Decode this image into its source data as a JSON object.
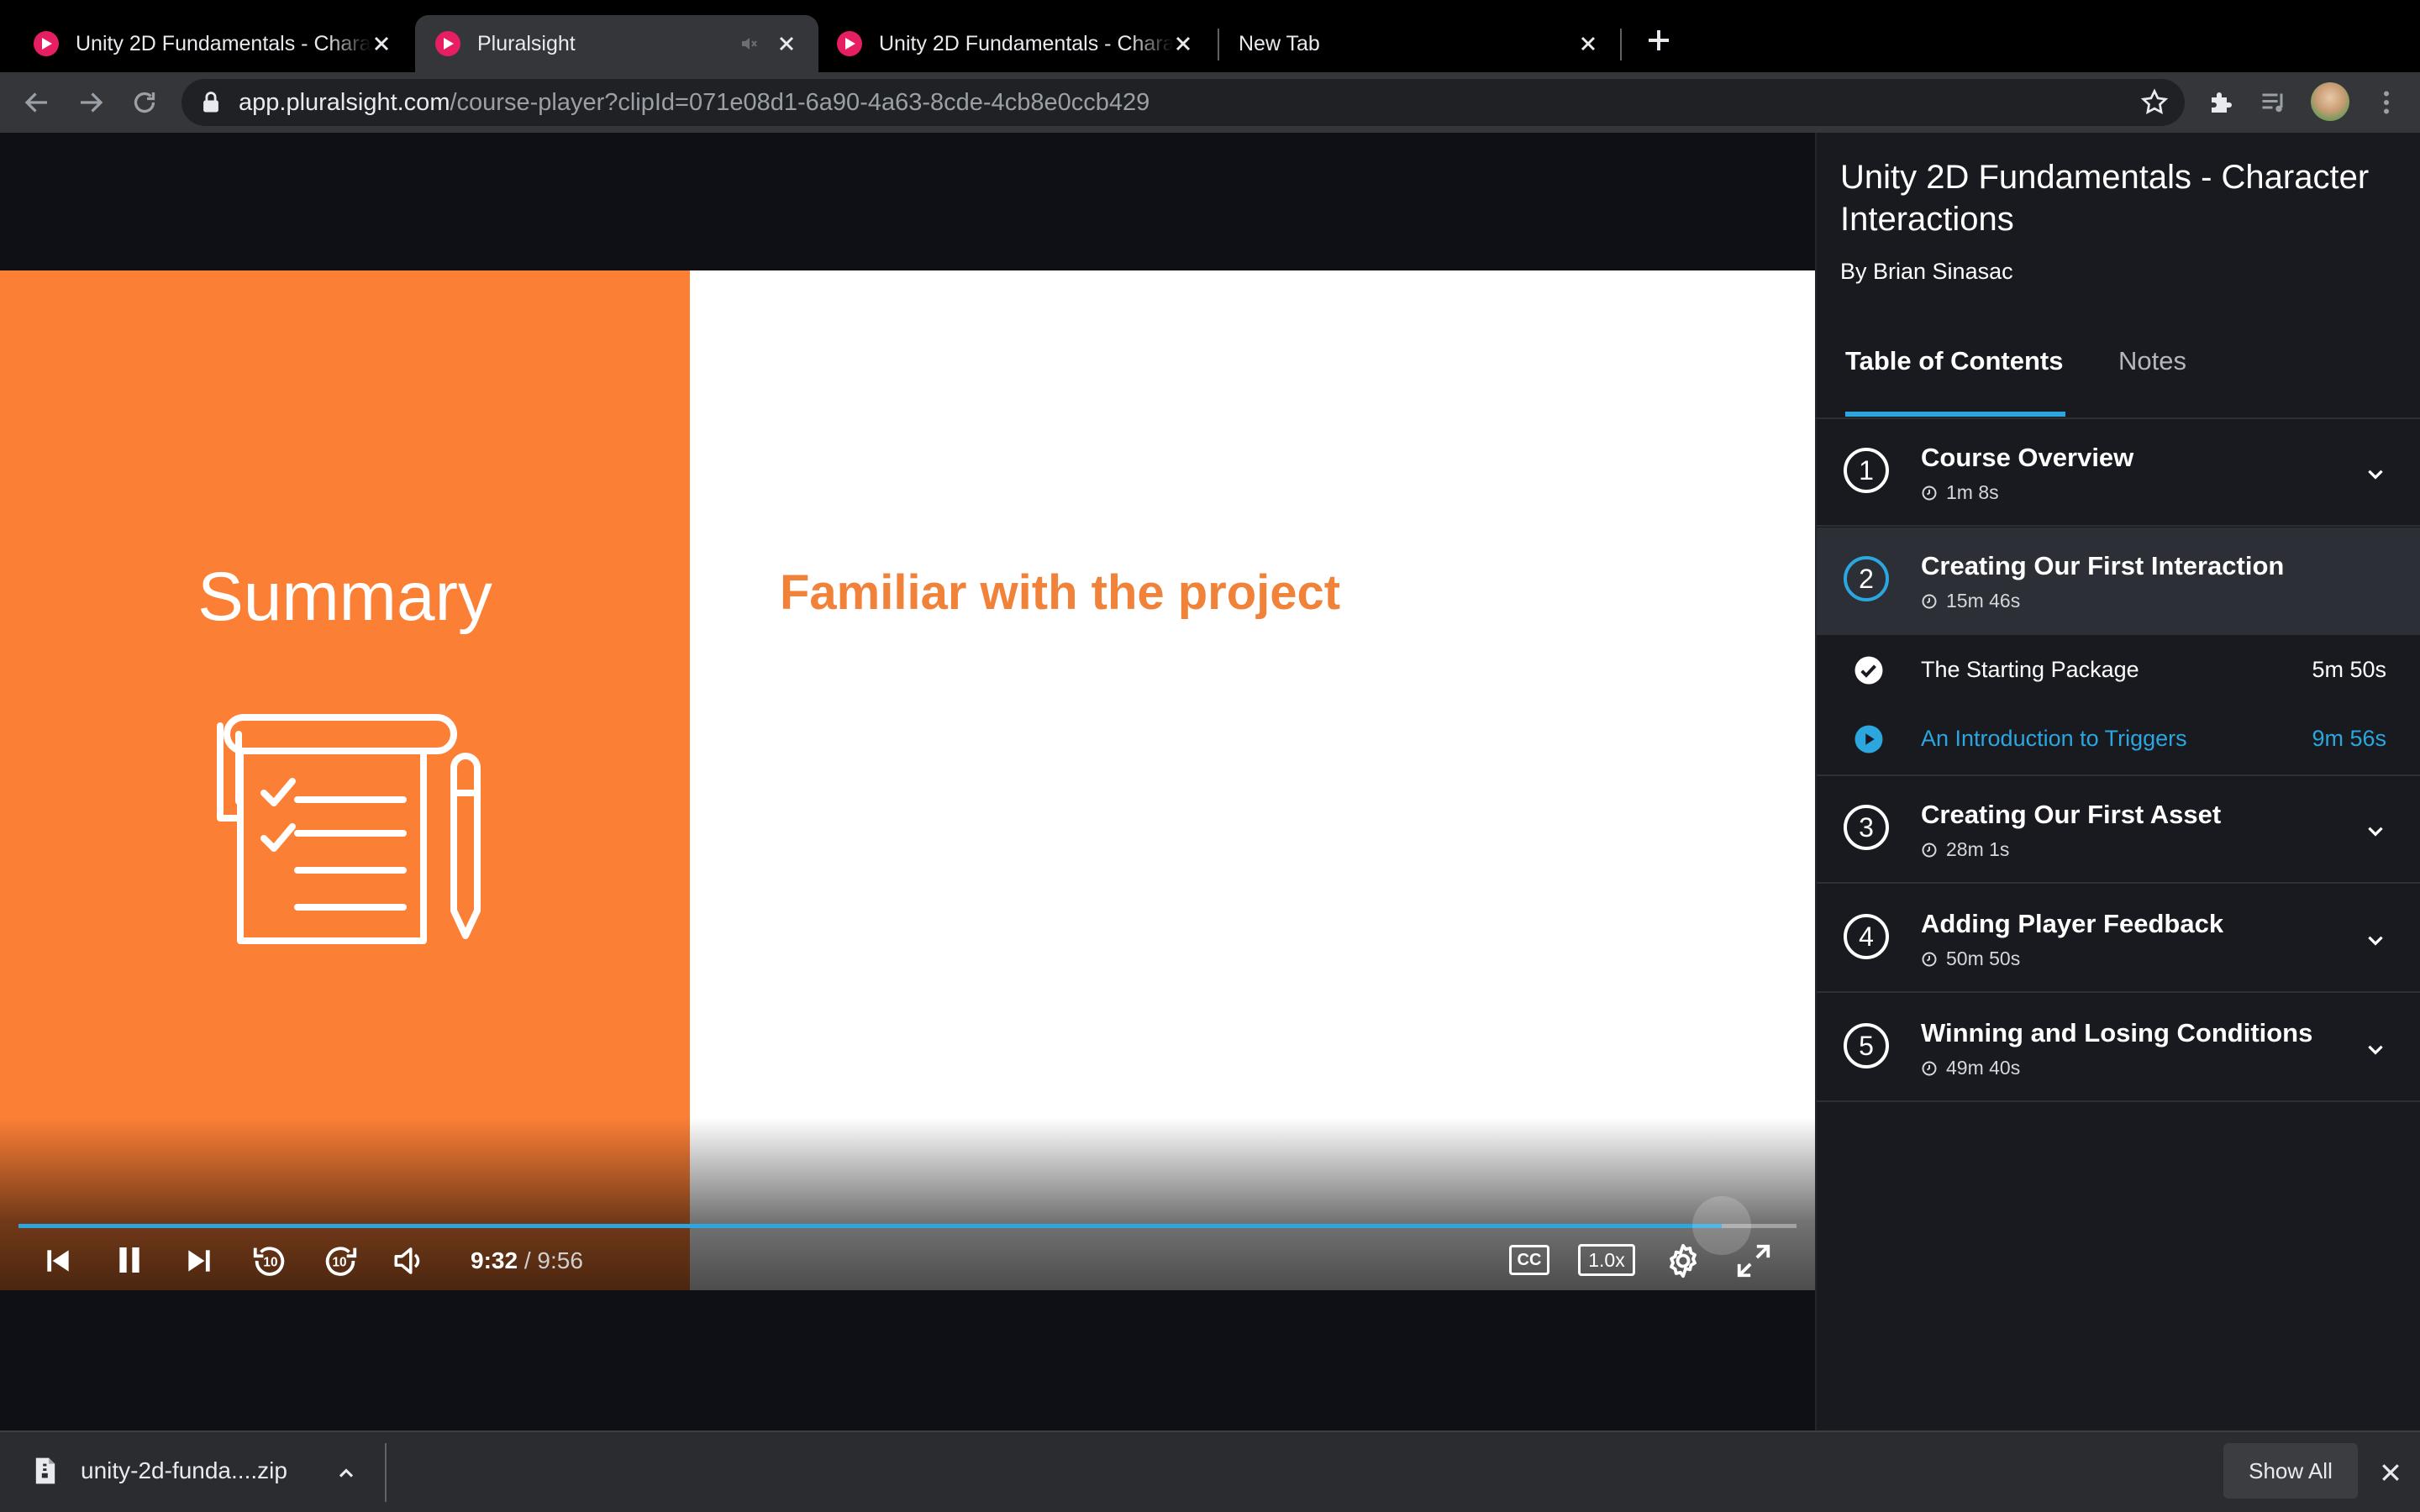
{
  "browser": {
    "tabs": [
      {
        "title": "Unity 2D Fundamentals - Character Interactions",
        "active": false
      },
      {
        "title": "Pluralsight",
        "active": true,
        "audible": true
      },
      {
        "title": "Unity 2D Fundamentals - Character Interactions",
        "active": false
      },
      {
        "title": "New Tab",
        "active": false
      }
    ],
    "url_host": "app.pluralsight.com",
    "url_path": "/course-player?clipId=071e08d1-6a90-4a63-8cde-4cb8e0ccb429"
  },
  "video": {
    "slide_heading": "Summary",
    "slide_bullet": "Familiar with the project",
    "current_time": "9:32",
    "separator": "/",
    "total_time": "9:56",
    "progress": 0.958,
    "cc_label": "CC",
    "speed_label": "1.0x"
  },
  "sidebar": {
    "course_title": "Unity 2D Fundamentals - Character Interactions",
    "author": "By Brian Sinasac",
    "tabs": {
      "toc": "Table of Contents",
      "notes": "Notes"
    },
    "modules": [
      {
        "number": "1",
        "name": "Course Overview",
        "duration": "1m 8s"
      },
      {
        "number": "2",
        "name": "Creating Our First Interaction",
        "duration": "15m 46s"
      },
      {
        "number": "3",
        "name": "Creating Our First Asset",
        "duration": "28m 1s"
      },
      {
        "number": "4",
        "name": "Adding Player Feedback",
        "duration": "50m 50s"
      },
      {
        "number": "5",
        "name": "Winning and Losing Conditions",
        "duration": "49m 40s"
      }
    ],
    "clips": [
      {
        "name": "The Starting Package",
        "duration": "5m 50s",
        "status": "completed"
      },
      {
        "name": "An Introduction to Triggers",
        "duration": "9m 56s",
        "status": "playing"
      }
    ]
  },
  "downloads": {
    "file_name": "unity-2d-funda....zip",
    "show_all": "Show All"
  },
  "colors": {
    "accent": "#2ba6de",
    "slide_orange": "#fc7f36",
    "brand_pink": "#e81e63"
  }
}
